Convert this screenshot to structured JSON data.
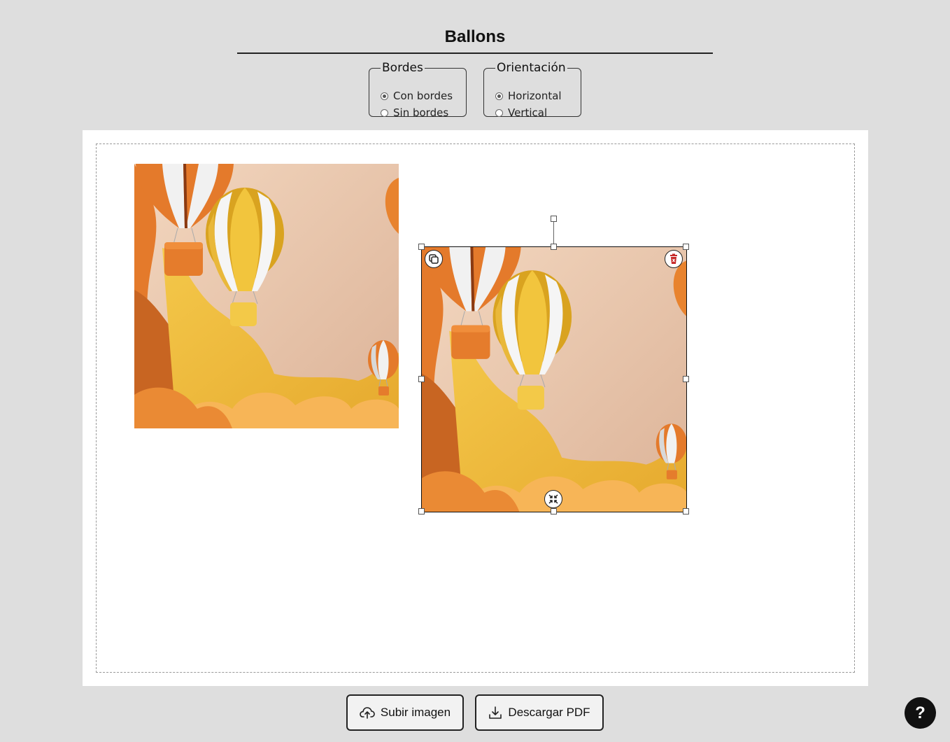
{
  "header": {
    "title": "Ballons"
  },
  "options": {
    "borders": {
      "legend": "Bordes",
      "items": [
        {
          "label": "Con bordes",
          "checked": true
        },
        {
          "label": "Sin bordes",
          "checked": false
        }
      ]
    },
    "orientation": {
      "legend": "Orientación",
      "items": [
        {
          "label": "Horizontal",
          "checked": true
        },
        {
          "label": "Vertical",
          "checked": false
        }
      ]
    }
  },
  "canvas": {
    "images": [
      {
        "name": "balloons-image-1",
        "selected": false
      },
      {
        "name": "balloons-image-2",
        "selected": true
      }
    ],
    "selection_controls": [
      "duplicate-icon",
      "delete-icon",
      "compress-icon",
      "rotate-handle"
    ]
  },
  "actions": {
    "upload_label": "Subir imagen",
    "upload_icon": "cloud-upload-icon",
    "download_label": "Descargar PDF",
    "download_icon": "download-icon"
  },
  "help": {
    "label": "?"
  },
  "colors": {
    "delete": "#c62828",
    "background": "#dedede",
    "paper": "#ffffff"
  }
}
